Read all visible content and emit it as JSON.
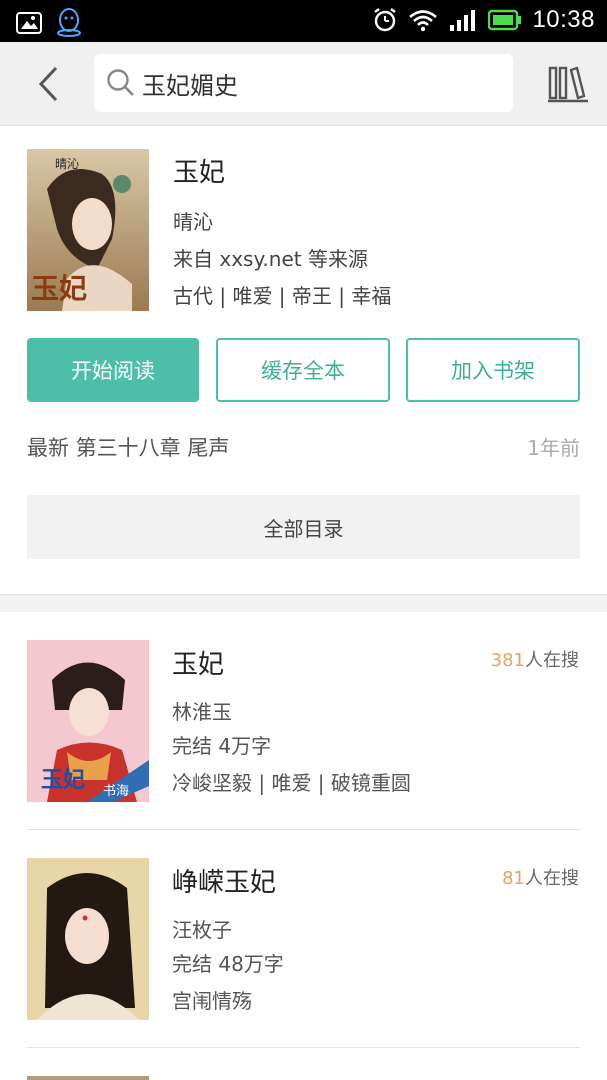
{
  "status_bar": {
    "time": "10:38",
    "icons": [
      "gallery-icon",
      "qq-icon",
      "alarm-icon",
      "wifi-icon",
      "signal-icon",
      "battery-icon"
    ]
  },
  "topbar": {
    "search_value": "玉妃媚史"
  },
  "main_book": {
    "title": "玉妃",
    "author": "晴沁",
    "source": "来自 xxsy.net 等来源",
    "tags": "古代 | 唯爱 | 帝王 | 幸福",
    "buttons": {
      "read": "开始阅读",
      "cache": "缓存全本",
      "add_shelf": "加入书架"
    },
    "latest": "最新 第三十八章 尾声",
    "latest_time": "1年前",
    "toc": "全部目录",
    "cover_text": "玉妃",
    "cover_small_text": "晴沁"
  },
  "results": [
    {
      "title": "玉妃",
      "author": "林淮玉",
      "status": "完结  4万字",
      "tags": "冷峻坚毅 | 唯爱 | 破镜重圆",
      "search_count": "381",
      "search_suffix": "人在搜",
      "cover_text": "玉妃",
      "cover_band_text": "书海"
    },
    {
      "title": "峥嵘玉妃",
      "author": "汪枚子",
      "status": "完结  48万字",
      "tags": "宫闱情殇",
      "search_count": "81",
      "search_suffix": "人在搜"
    }
  ],
  "colors": {
    "accent": "#4dbfa9",
    "search_count": "#e8a464"
  }
}
